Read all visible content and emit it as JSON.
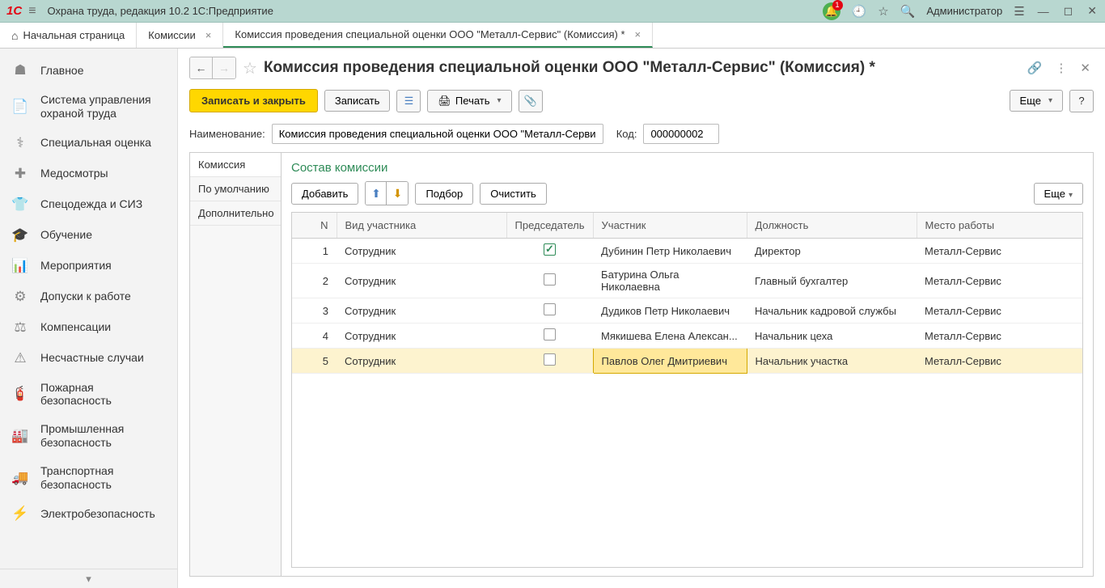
{
  "app": {
    "title": "Охрана труда, редакция 10.2 1С:Предприятие",
    "user": "Администратор",
    "notif_count": "1"
  },
  "tabs": [
    {
      "label": "Начальная страница",
      "closable": false,
      "home": true
    },
    {
      "label": "Комиссии",
      "closable": true
    },
    {
      "label": "Комиссия проведения специальной оценки ООО \"Металл-Сервис\" (Комиссия) *",
      "closable": true,
      "active": true
    }
  ],
  "sidebar": {
    "items": [
      {
        "icon": "☗",
        "label": "Главное"
      },
      {
        "icon": "📄",
        "label": "Система управления охраной труда"
      },
      {
        "icon": "⚕",
        "label": "Специальная оценка"
      },
      {
        "icon": "✚",
        "label": "Медосмотры"
      },
      {
        "icon": "👕",
        "label": "Спецодежда и СИЗ"
      },
      {
        "icon": "🎓",
        "label": "Обучение"
      },
      {
        "icon": "📊",
        "label": "Мероприятия"
      },
      {
        "icon": "⚙",
        "label": "Допуски к работе"
      },
      {
        "icon": "⚖",
        "label": "Компенсации"
      },
      {
        "icon": "⚠",
        "label": "Несчастные случаи"
      },
      {
        "icon": "🧯",
        "label": "Пожарная безопасность"
      },
      {
        "icon": "🏭",
        "label": "Промышленная безопасность"
      },
      {
        "icon": "🚚",
        "label": "Транспортная безопасность"
      },
      {
        "icon": "⚡",
        "label": "Электробезопасность"
      }
    ]
  },
  "page": {
    "title": "Комиссия проведения специальной оценки ООО \"Металл-Сервис\" (Комиссия) *"
  },
  "toolbar": {
    "save_close": "Записать и закрыть",
    "save": "Записать",
    "print": "Печать",
    "more": "Еще",
    "help": "?"
  },
  "form": {
    "name_label": "Наименование:",
    "name_value": "Комиссия проведения специальной оценки ООО \"Металл-Сервис\"",
    "code_label": "Код:",
    "code_value": "000000002"
  },
  "vtabs": [
    {
      "label": "Комиссия",
      "active": true
    },
    {
      "label": "По умолчанию"
    },
    {
      "label": "Дополнительно"
    }
  ],
  "panel": {
    "title": "Состав комиссии",
    "add": "Добавить",
    "select": "Подбор",
    "clear": "Очистить",
    "more": "Еще"
  },
  "table": {
    "headers": {
      "n": "N",
      "type": "Вид участника",
      "chair": "Председатель",
      "member": "Участник",
      "position": "Должность",
      "workplace": "Место работы"
    },
    "rows": [
      {
        "n": "1",
        "type": "Сотрудник",
        "chair": true,
        "member": "Дубинин Петр Николаевич",
        "position": "Директор",
        "workplace": "Металл-Сервис"
      },
      {
        "n": "2",
        "type": "Сотрудник",
        "chair": false,
        "member": "Батурина Ольга Николаевна",
        "position": "Главный бухгалтер",
        "workplace": "Металл-Сервис"
      },
      {
        "n": "3",
        "type": "Сотрудник",
        "chair": false,
        "member": "Дудиков Петр Николаевич",
        "position": "Начальник кадровой службы",
        "workplace": "Металл-Сервис"
      },
      {
        "n": "4",
        "type": "Сотрудник",
        "chair": false,
        "member": "Мякишева Елена Алексан...",
        "position": "Начальник цеха",
        "workplace": "Металл-Сервис"
      },
      {
        "n": "5",
        "type": "Сотрудник",
        "chair": false,
        "member": "Павлов Олег Дмитриевич",
        "position": "Начальник участка",
        "workplace": "Металл-Сервис",
        "selected": true
      }
    ]
  }
}
